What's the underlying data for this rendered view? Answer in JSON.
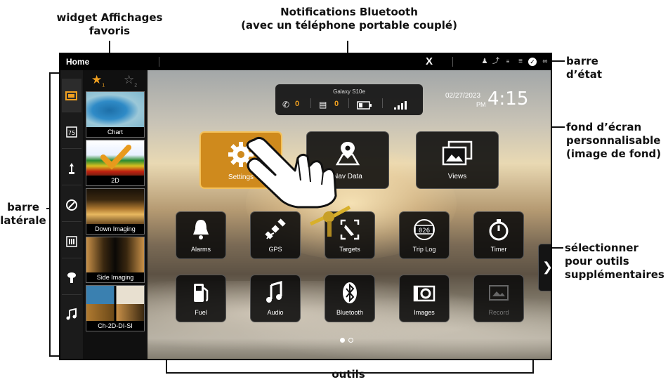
{
  "callouts": {
    "favorites_widget": "widget Affichages\nfavoris",
    "bt_notifications": "Notifications Bluetooth\n(avec un téléphone portable couplé)",
    "status_bar": "barre\nd’état",
    "wallpaper": "fond d’écran\npersonnalisable\n(image de fond)",
    "sidebar": "barre\nlatérale",
    "more_tools": "sélectionner\npour outils\nsupplémentaires",
    "tools": "outils"
  },
  "status_bar": {
    "title": "Home",
    "bluetooth_mark": "X",
    "icons": [
      "person-icon",
      "signal-icon",
      "usb-icon",
      "stack-icon",
      "check-icon",
      "link-icon"
    ]
  },
  "notification": {
    "device_name": "Galaxy S10e",
    "missed_calls": "0",
    "messages": "0"
  },
  "clock": {
    "date": "02/27/2023",
    "ampm": "PM",
    "time": "4:15"
  },
  "favorites": {
    "tabs": [
      "1",
      "2"
    ],
    "items": [
      {
        "label": "Chart"
      },
      {
        "label": "2D"
      },
      {
        "label": "Down Imaging"
      },
      {
        "label": "Side Imaging"
      },
      {
        "label": "Ch-2D-DI-SI"
      }
    ]
  },
  "sidebar": {
    "items": [
      {
        "icon": "views-icon"
      },
      {
        "icon": "temperature-icon",
        "value": "75"
      },
      {
        "icon": "trolling-motor-icon"
      },
      {
        "icon": "autopilot-icon"
      },
      {
        "icon": "switches-icon"
      },
      {
        "icon": "outboard-motor-icon"
      },
      {
        "icon": "music-icon"
      }
    ]
  },
  "tools": {
    "row1": [
      {
        "label": "Settings",
        "icon": "gear-icon",
        "selected": true
      },
      {
        "label": "Nav Data",
        "icon": "map-pin-icon"
      },
      {
        "label": "Views",
        "icon": "images-icon"
      }
    ],
    "row2": [
      {
        "label": "Alarms",
        "icon": "bell-icon"
      },
      {
        "label": "GPS",
        "icon": "satellite-icon"
      },
      {
        "label": "Targets",
        "icon": "targets-icon"
      },
      {
        "label": "Trip Log",
        "icon": "trip-log-icon",
        "counter": "026"
      },
      {
        "label": "Timer",
        "icon": "stopwatch-icon"
      }
    ],
    "row3": [
      {
        "label": "Fuel",
        "icon": "fuel-icon"
      },
      {
        "label": "Audio",
        "icon": "music-note-icon"
      },
      {
        "label": "Bluetooth",
        "icon": "bluetooth-icon"
      },
      {
        "label": "Images",
        "icon": "camera-icon"
      },
      {
        "label": "Record",
        "icon": "record-icon",
        "disabled": true
      }
    ]
  },
  "pager": {
    "pages": 2,
    "current": 1
  },
  "colors": {
    "accent": "#cf8a1d",
    "star_active": "#f0a020"
  }
}
